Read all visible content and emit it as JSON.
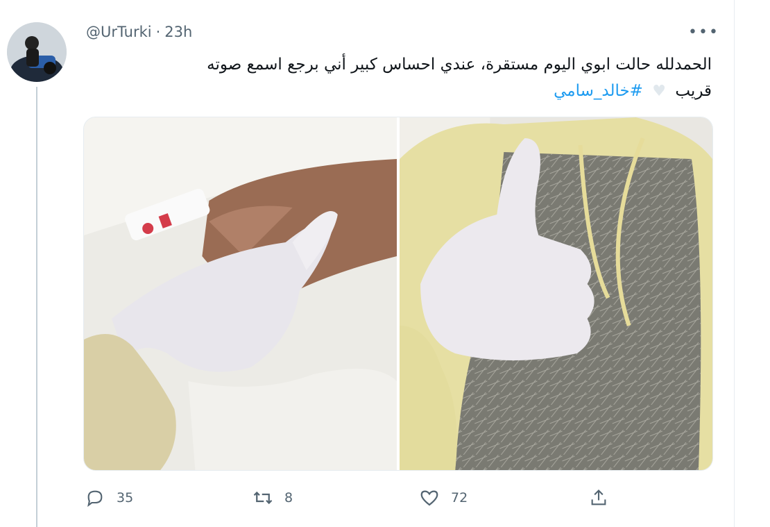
{
  "tweet": {
    "handle": "@UrTurki",
    "separator": "·",
    "time": "23h",
    "more": "•••",
    "text_line1": "الحمدلله حالت ابوي اليوم مستقرة، عندي احساس كبير أني برجع اسمع صوته",
    "text_line2_prefix": "قريب",
    "hashtag": "#خالد_سامي",
    "heart_emoji": "♥"
  },
  "actions": {
    "reply_count": "35",
    "retweet_count": "8",
    "like_count": "72"
  },
  "icons": {
    "reply": "reply-icon",
    "retweet": "retweet-icon",
    "like": "like-icon",
    "share": "share-icon"
  },
  "colors": {
    "hashtag": "#1d9bf0",
    "secondary_text": "#536471"
  }
}
